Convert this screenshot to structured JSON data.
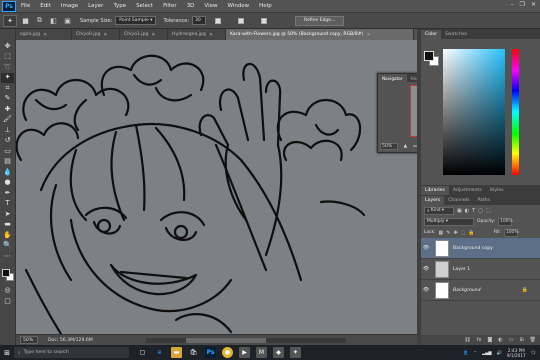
{
  "app": {
    "logo": "Ps"
  },
  "menubar": {
    "items": [
      "File",
      "Edit",
      "Image",
      "Layer",
      "Type",
      "Select",
      "Filter",
      "3D",
      "View",
      "Window",
      "Help"
    ],
    "window_controls": [
      "–",
      "❐",
      "✕"
    ]
  },
  "options": {
    "sample_size_label": "Sample Size:",
    "sample_size_value": "Point Sample",
    "tolerance_label": "Tolerance:",
    "tolerance_value": "30",
    "refine_button": "Refine Edge..."
  },
  "tabs": [
    {
      "label": "ogiro.jpg",
      "active": false
    },
    {
      "label": "Chiyo0.jpg",
      "active": false
    },
    {
      "label": "Chiyo1.jpg",
      "active": false
    },
    {
      "label": "Hydrangea.jpg",
      "active": false
    },
    {
      "label": "Kara-with-Flowers.jpg @ 50% (Background copy, RGB/8#)",
      "active": true
    }
  ],
  "status": {
    "zoom": "50%",
    "doc": "Doc: 56.3M/129.6M"
  },
  "navigator": {
    "tabs": [
      "Navigator",
      "Histogram"
    ],
    "zoom": "50%"
  },
  "color_panel": {
    "tabs": [
      "Color",
      "Swatches"
    ]
  },
  "libraries_panel": {
    "tabs": [
      "Libraries",
      "Adjustments",
      "Styles"
    ]
  },
  "layers_panel": {
    "tabs": [
      "Layers",
      "Channels",
      "Paths"
    ],
    "kind_label": "Kind",
    "blend_mode": "Multiply",
    "opacity_label": "Opacity:",
    "opacity_value": "100%",
    "lock_label": "Lock:",
    "fill_label": "Fill:",
    "fill_value": "100%",
    "layers": [
      {
        "name": "Background copy",
        "selected": true,
        "locked": false
      },
      {
        "name": "Layer 1",
        "selected": false,
        "locked": false
      },
      {
        "name": "Background",
        "selected": false,
        "locked": true
      }
    ]
  },
  "taskbar": {
    "search_placeholder": "Type here to search",
    "time": "2:43 PM",
    "date": "9/1/2017"
  }
}
